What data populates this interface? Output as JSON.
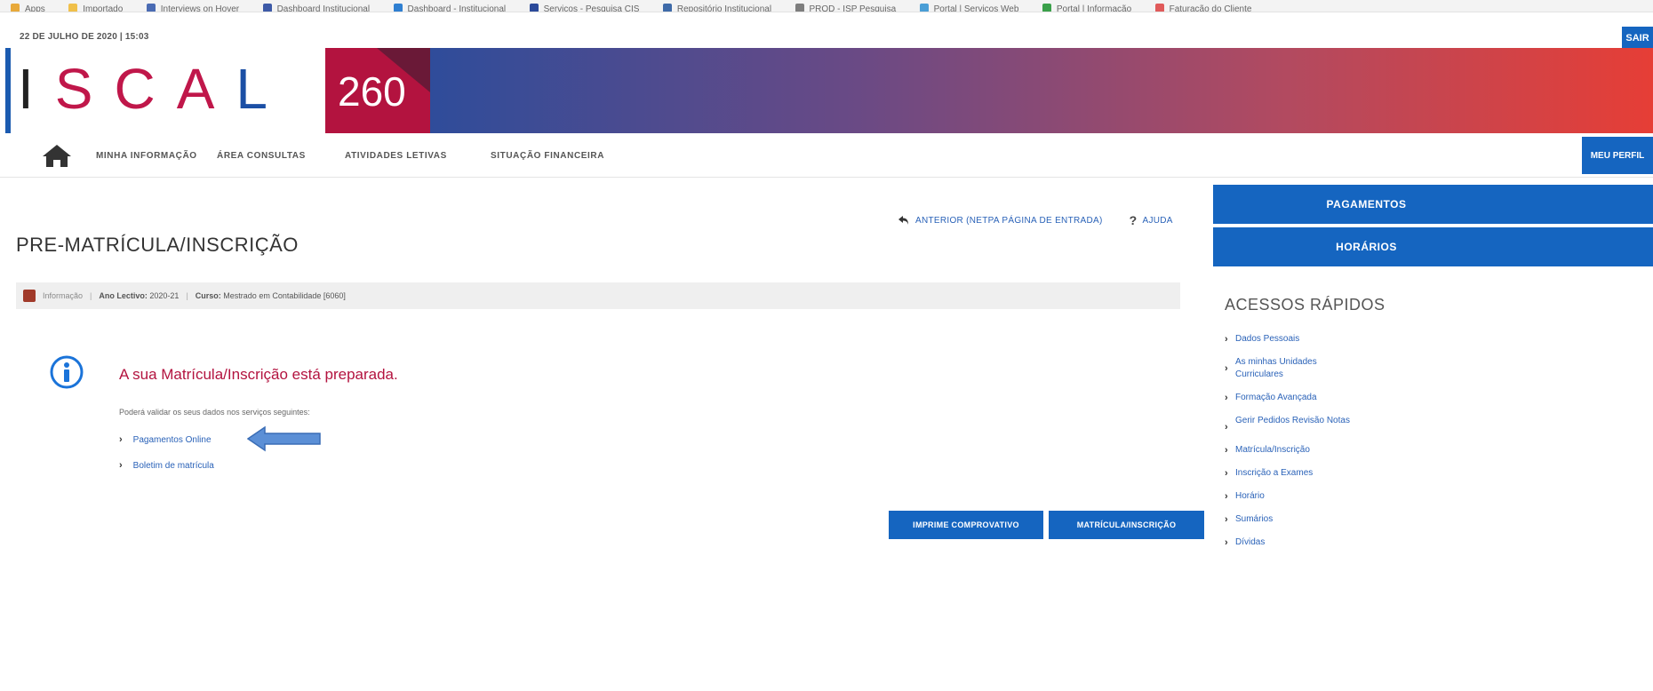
{
  "browser": {
    "bookmarks": [
      {
        "label": "Apps",
        "color": "#e8a93a"
      },
      {
        "label": "Importado",
        "color": "#f0c04a"
      },
      {
        "label": "Interviews on Hover",
        "color": "#4a6bb3"
      },
      {
        "label": "Dashboard Institucional",
        "color": "#3d5aa7"
      },
      {
        "label": "Dashboard - Institucional",
        "color": "#2f7fd1"
      },
      {
        "label": "Serviços - Pesquisa CIS",
        "color": "#2b4a9a"
      },
      {
        "label": "Repositório Institucional",
        "color": "#3e6aa8"
      },
      {
        "label": "PROD - ISP Pesquisa",
        "color": "#7d7d7d"
      },
      {
        "label": "Portal | Serviços Web",
        "color": "#4a9ed6"
      },
      {
        "label": "Portal | Informação",
        "color": "#3aa04a"
      },
      {
        "label": "Faturação do Cliente",
        "color": "#e05a5a"
      }
    ]
  },
  "header": {
    "date": "22 DE JULHO DE 2020 | 15:03",
    "logout_label": "SAIR",
    "logo_letters": [
      "I",
      "S",
      "C",
      "A",
      "L"
    ],
    "logo_badge": "260"
  },
  "nav": {
    "items": [
      "MINHA INFORMAÇÃO",
      "ÁREA CONSULTAS",
      "ATIVIDADES LETIVAS",
      "SITUAÇÃO FINANCEIRA"
    ],
    "profile_label": "MEU PERFIL"
  },
  "toplinks": {
    "back_label": "ANTERIOR (NETPA PÁGINA DE ENTRADA)",
    "help_symbol": "?",
    "help_label": "AJUDA"
  },
  "page": {
    "title": "PRE-MATRÍCULA/INSCRIÇÃO",
    "infobar": {
      "info_label": "Informação",
      "year_label": "Ano Lectivo:",
      "year_value": "2020-21",
      "course_label": "Curso:",
      "course_value": "Mestrado em Contabilidade [6060]"
    },
    "message_title": "A sua Matrícula/Inscrição está preparada.",
    "message_sub": "Poderá validar os seus dados nos serviços seguintes:",
    "links": [
      "Pagamentos Online",
      "Boletim de matrícula"
    ],
    "actions": [
      "IMPRIME COMPROVATIVO",
      "MATRÍCULA/INSCRIÇÃO"
    ]
  },
  "sidebar": {
    "buttons": [
      "PAGAMENTOS",
      "HORÁRIOS"
    ],
    "quick_title": "ACESSOS RÁPIDOS",
    "quick_links": [
      "Dados Pessoais",
      "As minhas Unidades Curriculares",
      "Formação Avançada",
      "Gerir Pedidos Revisão Notas",
      "Matrícula/Inscrição",
      "Inscrição a Exames",
      "Horário",
      "Sumários",
      "Dívidas"
    ]
  },
  "colors": {
    "primary_blue": "#1565c0",
    "brand_red": "#b3133f",
    "link_blue": "#2a62b8"
  }
}
